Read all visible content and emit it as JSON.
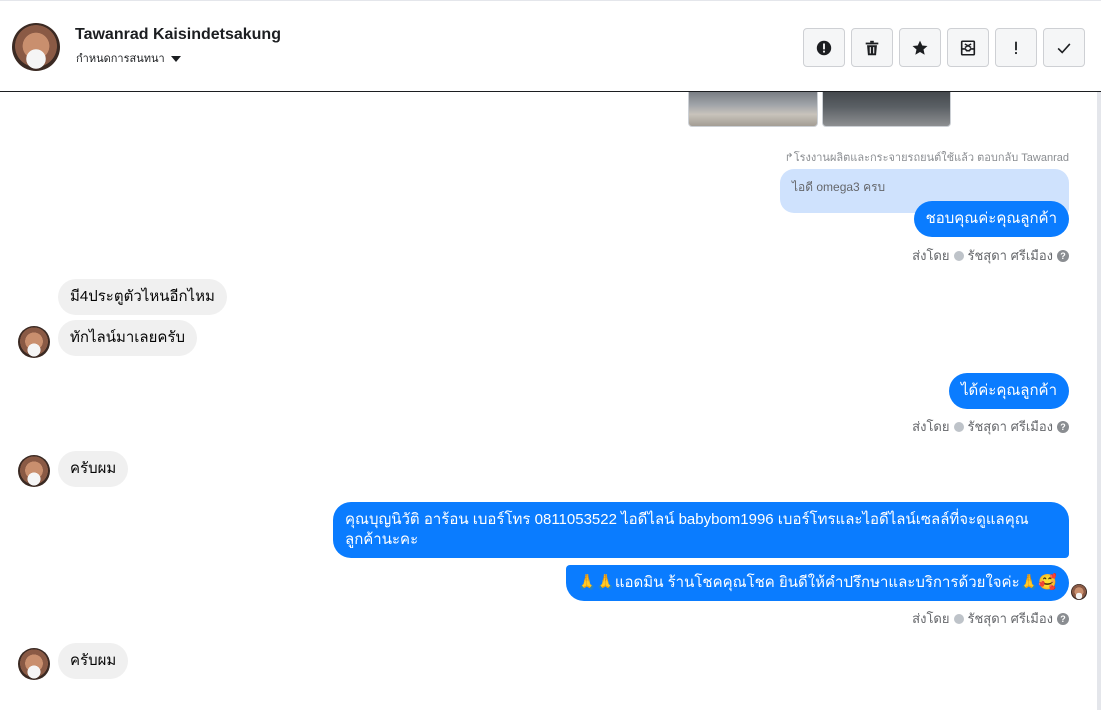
{
  "header": {
    "name": "Tawanrad Kaisindetsakung",
    "subtitle": "กำหนดการสนทนา",
    "actions": [
      {
        "name": "report-spam-button",
        "icon": "alert-circle-icon"
      },
      {
        "name": "delete-button",
        "icon": "trash-icon"
      },
      {
        "name": "star-button",
        "icon": "star-icon"
      },
      {
        "name": "archive-button",
        "icon": "archive-icon"
      },
      {
        "name": "mark-important-button",
        "icon": "exclamation-icon"
      },
      {
        "name": "mark-done-button",
        "icon": "check-icon"
      }
    ]
  },
  "thread": {
    "reply_label": "โรงงานผลิตและกระจายรถยนต์ใช้แล้ว ตอบกลับ Tawanrad",
    "quoted_text": "ไอดี omega3 ครบ",
    "messages": [
      {
        "from": "page",
        "text": "ชอบคุณค่ะคุณลูกค้า"
      },
      {
        "from": "customer",
        "text": "มี4ประตูตัวไหนอีกไหม"
      },
      {
        "from": "customer",
        "text": "ทักไลน์มาเลยครับ"
      },
      {
        "from": "page",
        "text": "ได้ค่ะคุณลูกค้า"
      },
      {
        "from": "customer",
        "text": "ครับผม"
      },
      {
        "from": "page",
        "text": "คุณบุญนิวัติ  อาร้อน        เบอร์โทร 0811053522  ไอดีไลน์ babybom1996   เบอร์โทรและไอดีไลน์เซลล์ที่จะดูแลคุณลูกค้านะคะ"
      },
      {
        "from": "page",
        "text": "🙏🙏แอดมิน ร้านโชคคุณโชค ยินดีให้คำปรึกษาและบริการด้วยใจค่ะ🙏🥰"
      },
      {
        "from": "customer",
        "text": "ครับผม"
      }
    ],
    "sent_by_prefix": "ส่งโดย",
    "sent_by_name": "รัชสุดา ศรีเมือง",
    "help_glyph": "?"
  },
  "colors": {
    "outgoing_bubble": "#0a7cff",
    "incoming_bubble": "#f0f0f0",
    "quoted_bubble": "#cfe2fd"
  }
}
